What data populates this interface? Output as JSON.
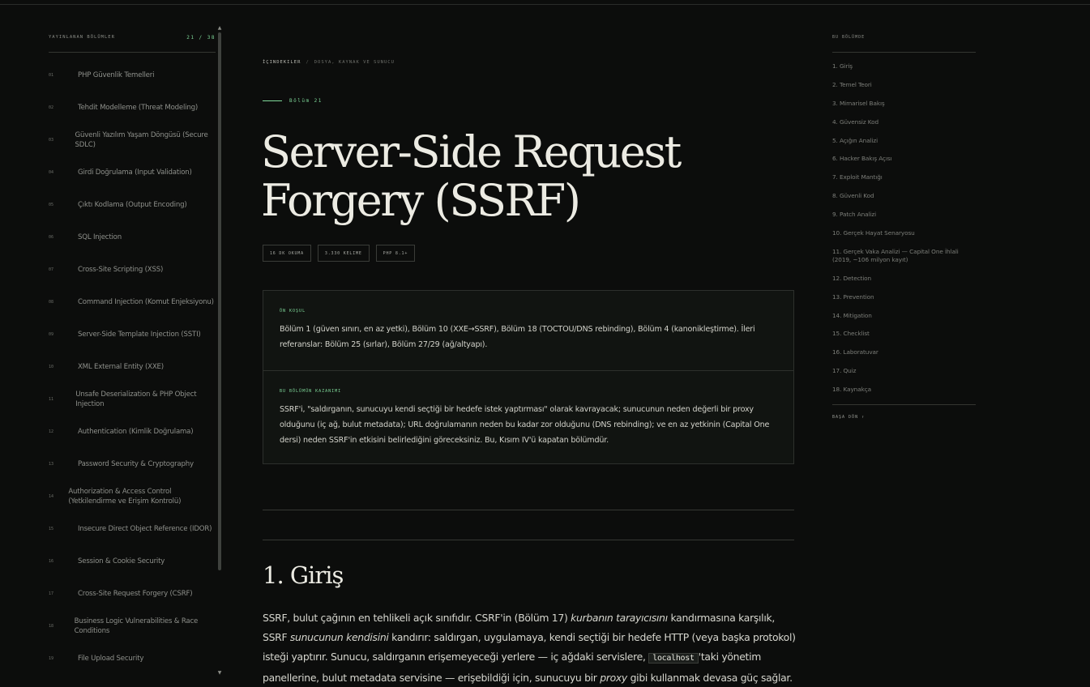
{
  "sidebar": {
    "heading": "Yayınlanan Bölümler",
    "count": "21 / 38",
    "items": [
      {
        "num": "01",
        "label": "PHP Güvenlik Temelleri"
      },
      {
        "num": "02",
        "label": "Tehdit Modelleme (Threat Modeling)"
      },
      {
        "num": "03",
        "label": "Güvenli Yazılım Yaşam Döngüsü (Secure SDLC)"
      },
      {
        "num": "04",
        "label": "Girdi Doğrulama (Input Validation)"
      },
      {
        "num": "05",
        "label": "Çıktı Kodlama (Output Encoding)"
      },
      {
        "num": "06",
        "label": "SQL Injection"
      },
      {
        "num": "07",
        "label": "Cross-Site Scripting (XSS)"
      },
      {
        "num": "08",
        "label": "Command Injection (Komut Enjeksiyonu)"
      },
      {
        "num": "09",
        "label": "Server-Side Template Injection (SSTI)"
      },
      {
        "num": "10",
        "label": "XML External Entity (XXE)"
      },
      {
        "num": "11",
        "label": "Unsafe Deserialization & PHP Object Injection"
      },
      {
        "num": "12",
        "label": "Authentication (Kimlik Doğrulama)"
      },
      {
        "num": "13",
        "label": "Password Security & Cryptography"
      },
      {
        "num": "14",
        "label": "Authorization & Access Control (Yetkilendirme ve Erişim Kontrolü)"
      },
      {
        "num": "15",
        "label": "Insecure Direct Object Reference (IDOR)"
      },
      {
        "num": "16",
        "label": "Session & Cookie Security"
      },
      {
        "num": "17",
        "label": "Cross-Site Request Forgery (CSRF)"
      },
      {
        "num": "18",
        "label": "Business Logic Vulnerabilities & Race Conditions"
      },
      {
        "num": "19",
        "label": "File Upload Security"
      }
    ],
    "scroll_up_icon": "▲",
    "scroll_down_icon": "▼"
  },
  "breadcrumb": {
    "root": "İçindekiler",
    "separator": "/",
    "current": "Dosya, Kaynak ve Sunucu"
  },
  "chapter_label": "Bölüm 21",
  "title": "Server-Side Request Forgery (SSRF)",
  "meta": [
    "16 dk okuma",
    "3.330 kelime",
    "PHP 8.1+"
  ],
  "prereq": {
    "heading": "Ön Koşul",
    "text": "Bölüm 1 (güven sınırı, en az yetki), Bölüm 10 (XXE→SSRF), Bölüm 18 (TOCTOU/DNS rebinding), Bölüm 4 (kanonikleştirme). İleri referanslar: Bölüm 25 (sırlar), Bölüm 27/29 (ağ/altyapı)."
  },
  "gain": {
    "heading": "Bu Bölümün Kazanımı",
    "text": "SSRF'i, \"saldırganın, sunucuyu kendi seçtiği bir hedefe istek yaptırması\" olarak kavrayacak; sunucunun neden değerli bir proxy olduğunu (iç ağ, bulut metadata); URL doğrulamanın neden bu kadar zor olduğunu (DNS rebinding); ve en az yetkinin (Capital One dersi) neden SSRF'in etkisini belirlediğini göreceksiniz. Bu, Kısım IV'ü kapatan bölümdür."
  },
  "section": {
    "heading": "1. Giriş",
    "p_parts": {
      "a": "SSRF, bulut çağının en tehlikeli açık sınıfıdır. CSRF'in (Bölüm 17) ",
      "b": "kurbanın tarayıcısını",
      "c": " kandırmasına karşılık, SSRF ",
      "d": "sunucunun kendisini",
      "e": " kandırır: saldırgan, uygulamaya, kendi seçtiği bir hedefe HTTP (veya başka protokol) isteği yaptırır. Sunucu, saldırganın erişemeyeceği yerlere — iç ağdaki servislere, ",
      "code": "localhost",
      "f": "'taki yönetim panellerine, bulut metadata servisine — erişebildiği için, sunucuyu bir ",
      "g": "proxy",
      "h": " gibi kullanmak devasa güç sağlar."
    }
  },
  "toc": {
    "heading": "Bu Bölümde",
    "items": [
      "1. Giriş",
      "2. Temel Teori",
      "3. Mimarisel Bakış",
      "4. Güvensiz Kod",
      "5. Açığın Analizi",
      "6. Hacker Bakış Açısı",
      "7. Exploit Mantığı",
      "8. Güvenli Kod",
      "9. Patch Analizi",
      "10. Gerçek Hayat Senaryosu",
      "11. Gerçek Vaka Analizi — Capital One İhlali (2019, ~106 milyon kayıt)",
      "12. Detection",
      "13. Prevention",
      "14. Mitigation",
      "15. Checklist",
      "16. Laboratuvar",
      "17. Quiz",
      "18. Kaynakça"
    ],
    "back_to_top": "Başa dön ↑"
  },
  "colors": {
    "accent": "#7fd99a",
    "background": "#0c0d0c",
    "panel": "#111411"
  }
}
